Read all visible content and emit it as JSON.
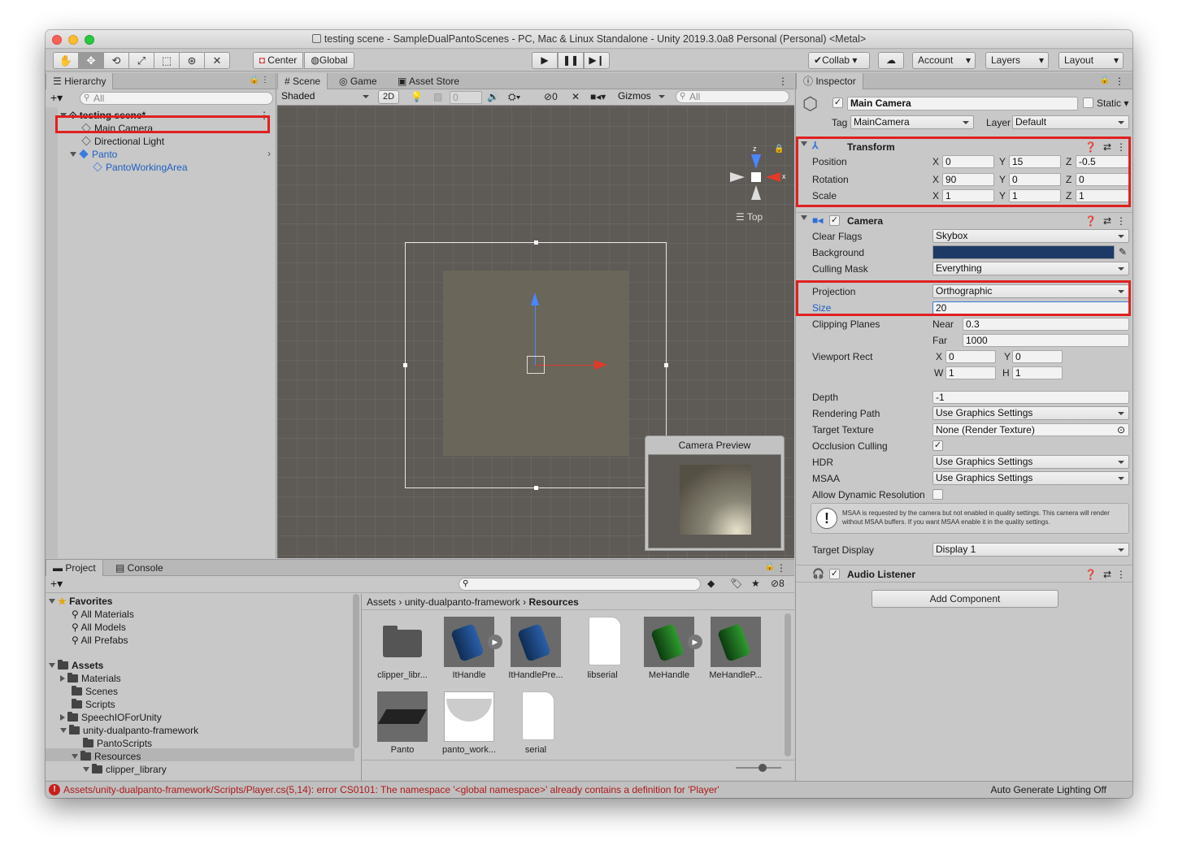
{
  "window": {
    "title": "testing scene - SampleDualPantoScenes - PC, Mac & Linux Standalone - Unity 2019.3.0a8 Personal (Personal) <Metal>"
  },
  "toolbar": {
    "center": "Center",
    "global": "Global",
    "collab": "Collab",
    "account": "Account",
    "layers": "Layers",
    "layout": "Layout"
  },
  "hierarchy": {
    "tab": "Hierarchy",
    "search_placeholder": "All",
    "scene": "testing scene*",
    "items": [
      "Main Camera",
      "Directional Light",
      "Panto",
      "PantoWorkingArea"
    ]
  },
  "scene": {
    "tabs": [
      "Scene",
      "Game",
      "Asset Store"
    ],
    "shading": "Shaded",
    "mode2d": "2D",
    "zero": "0",
    "hidden": "0",
    "gizmos": "Gizmos",
    "search_placeholder": "All",
    "orient": "Top",
    "axis_x": "x",
    "axis_z": "z",
    "camera_preview": "Camera Preview"
  },
  "project": {
    "tabs": [
      "Project",
      "Console"
    ],
    "favorites": "Favorites",
    "fav_items": [
      "All Materials",
      "All Models",
      "All Prefabs"
    ],
    "assets": "Assets",
    "tree": [
      "Materials",
      "Scenes",
      "Scripts",
      "SpeechIOForUnity",
      "unity-dualpanto-framework",
      "PantoScripts",
      "Resources",
      "clipper_library"
    ],
    "hidden_count": "8",
    "breadcrumb": [
      "Assets",
      "unity-dualpanto-framework",
      "Resources"
    ],
    "files": [
      "clipper_libr...",
      "ItHandle",
      "ItHandlePre...",
      "libserial",
      "MeHandle",
      "MeHandleP...",
      "Panto",
      "panto_work...",
      "serial"
    ]
  },
  "status": {
    "error": "Assets/unity-dualpanto-framework/Scripts/Player.cs(5,14): error CS0101: The namespace '<global namespace>' already contains a definition for 'Player'",
    "lighting": "Auto Generate Lighting Off"
  },
  "inspector": {
    "tab": "Inspector",
    "name": "Main Camera",
    "static": "Static",
    "tag_label": "Tag",
    "tag": "MainCamera",
    "layer_label": "Layer",
    "layer": "Default",
    "transform": {
      "title": "Transform",
      "position": "Position",
      "rotation": "Rotation",
      "scale": "Scale",
      "x": "X",
      "y": "Y",
      "z": "Z",
      "pos": [
        "0",
        "15",
        "-0.5"
      ],
      "rot": [
        "90",
        "0",
        "0"
      ],
      "scl": [
        "1",
        "1",
        "1"
      ]
    },
    "camera": {
      "title": "Camera",
      "clear_flags": "Clear Flags",
      "clear_flags_val": "Skybox",
      "background": "Background",
      "culling_mask": "Culling Mask",
      "culling_mask_val": "Everything",
      "projection": "Projection",
      "projection_val": "Orthographic",
      "size": "Size",
      "size_val": "20",
      "clipping": "Clipping Planes",
      "near": "Near",
      "near_val": "0.3",
      "far": "Far",
      "far_val": "1000",
      "viewport": "Viewport Rect",
      "vx": "0",
      "vy": "0",
      "vw": "1",
      "vh": "1",
      "w": "W",
      "h": "H",
      "depth": "Depth",
      "depth_val": "-1",
      "rendering_path": "Rendering Path",
      "rendering_path_val": "Use Graphics Settings",
      "target_texture": "Target Texture",
      "target_texture_val": "None (Render Texture)",
      "occlusion": "Occlusion Culling",
      "hdr": "HDR",
      "hdr_val": "Use Graphics Settings",
      "msaa": "MSAA",
      "msaa_val": "Use Graphics Settings",
      "dynres": "Allow Dynamic Resolution",
      "warning": "MSAA is requested by the camera but not enabled in quality settings. This camera will render without MSAA buffers. If you want MSAA enable it in the quality settings.",
      "target_display": "Target Display",
      "target_display_val": "Display 1"
    },
    "audio": {
      "title": "Audio Listener"
    },
    "add_component": "Add Component"
  },
  "colors": {
    "scene_bg": "#5e5a55",
    "selection": "#3d7ad6",
    "highlight": "#e02020",
    "error": "#c81e1e"
  }
}
